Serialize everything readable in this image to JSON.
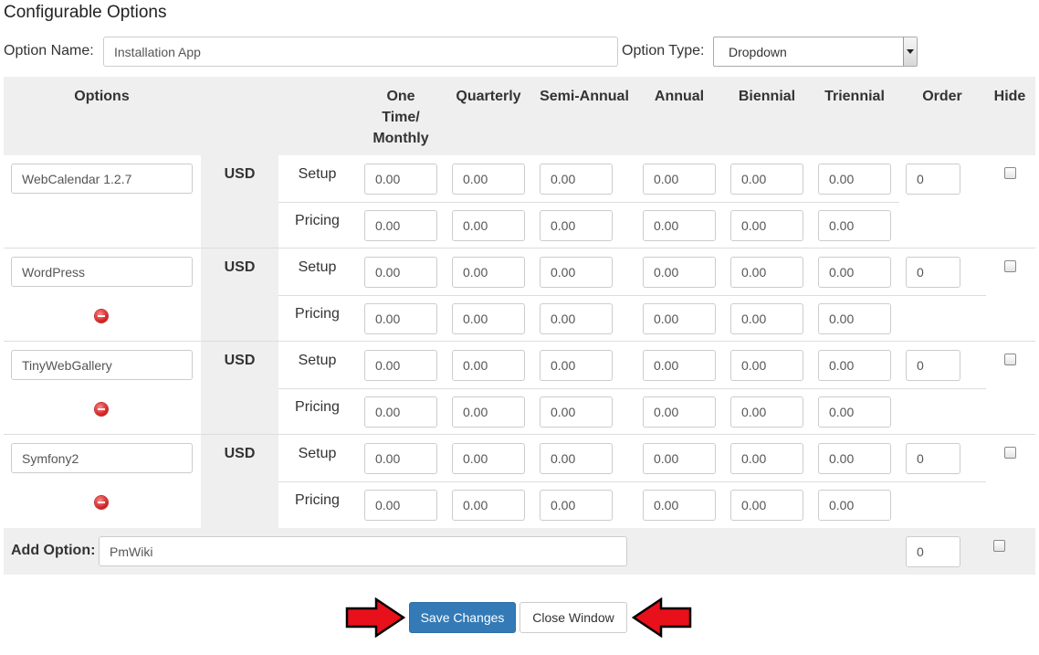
{
  "page_title": "Configurable Options",
  "option_name_label": "Option Name:",
  "option_name_value": "Installation App",
  "option_type_label": "Option Type:",
  "option_type_value": "Dropdown",
  "table": {
    "headers": {
      "options": "Options",
      "one_time_l1": "One",
      "one_time_l2": "Time/",
      "one_time_l3": "Monthly",
      "quarterly": "Quarterly",
      "semi_annual": "Semi-Annual",
      "annual": "Annual",
      "biennial": "Biennial",
      "triennial": "Triennial",
      "order": "Order",
      "hide": "Hide"
    },
    "rows": [
      {
        "name": "WebCalendar 1.2.7",
        "currency": "USD",
        "setup_label": "Setup",
        "pricing_label": "Pricing",
        "setup": [
          "0.00",
          "0.00",
          "0.00",
          "0.00",
          "0.00",
          "0.00"
        ],
        "pricing": [
          "0.00",
          "0.00",
          "0.00",
          "0.00",
          "0.00",
          "0.00"
        ],
        "order": "0",
        "hidden": false,
        "deletable": false
      },
      {
        "name": "WordPress",
        "currency": "USD",
        "setup_label": "Setup",
        "pricing_label": "Pricing",
        "setup": [
          "0.00",
          "0.00",
          "0.00",
          "0.00",
          "0.00",
          "0.00"
        ],
        "pricing": [
          "0.00",
          "0.00",
          "0.00",
          "0.00",
          "0.00",
          "0.00"
        ],
        "order": "0",
        "hidden": false,
        "deletable": true
      },
      {
        "name": "TinyWebGallery",
        "currency": "USD",
        "setup_label": "Setup",
        "pricing_label": "Pricing",
        "setup": [
          "0.00",
          "0.00",
          "0.00",
          "0.00",
          "0.00",
          "0.00"
        ],
        "pricing": [
          "0.00",
          "0.00",
          "0.00",
          "0.00",
          "0.00",
          "0.00"
        ],
        "order": "0",
        "hidden": false,
        "deletable": true
      },
      {
        "name": "Symfony2",
        "currency": "USD",
        "setup_label": "Setup",
        "pricing_label": "Pricing",
        "setup": [
          "0.00",
          "0.00",
          "0.00",
          "0.00",
          "0.00",
          "0.00"
        ],
        "pricing": [
          "0.00",
          "0.00",
          "0.00",
          "0.00",
          "0.00",
          "0.00"
        ],
        "order": "0",
        "hidden": false,
        "deletable": true
      }
    ],
    "add_option": {
      "label": "Add Option:",
      "value": "PmWiki",
      "order": "0",
      "hidden": false
    }
  },
  "buttons": {
    "save": "Save Changes",
    "close": "Close Window"
  },
  "colors": {
    "primary": "#337ab7",
    "arrow": "#e8101a",
    "table_shade": "#efefef"
  }
}
